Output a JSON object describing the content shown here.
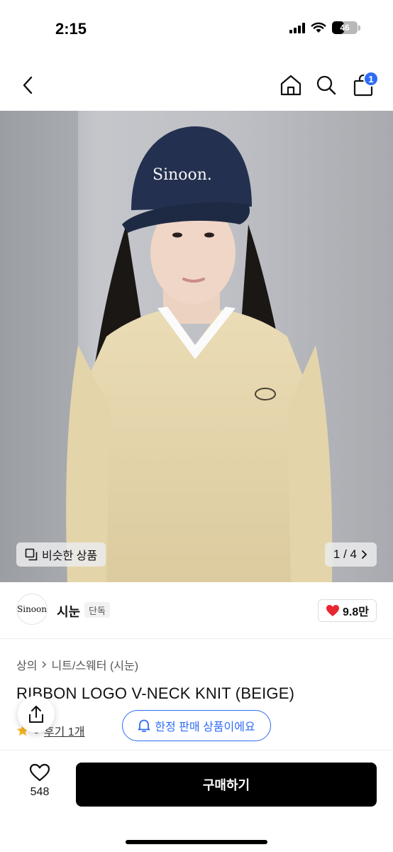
{
  "status_bar": {
    "time": "2:15",
    "battery": "46",
    "battery_level": 0.46
  },
  "nav": {
    "cart_count": "1",
    "icons": [
      "back-icon",
      "home-icon",
      "search-icon",
      "cart-icon"
    ]
  },
  "image": {
    "similar_label": "비슷한 상품",
    "page_indicator": "1 / 4",
    "cap_text": "Sinoon."
  },
  "brand": {
    "logo_text": "Sinoon",
    "name": "시눈",
    "badge": "단독",
    "likes": "9.8만",
    "heart_color": "#e8262f"
  },
  "product": {
    "breadcrumb": [
      "상의",
      "니트/스웨터 (시눈)"
    ],
    "title": "RIBBON LOGO V-NECK KNIT (BEIGE)",
    "rating": "5",
    "review_link": "후기 1개"
  },
  "banner": {
    "limited_label": "한정 판매 상품이에요",
    "accent": "#2f6cf6"
  },
  "bottom": {
    "wish_count": "548",
    "buy_label": "구매하기"
  }
}
